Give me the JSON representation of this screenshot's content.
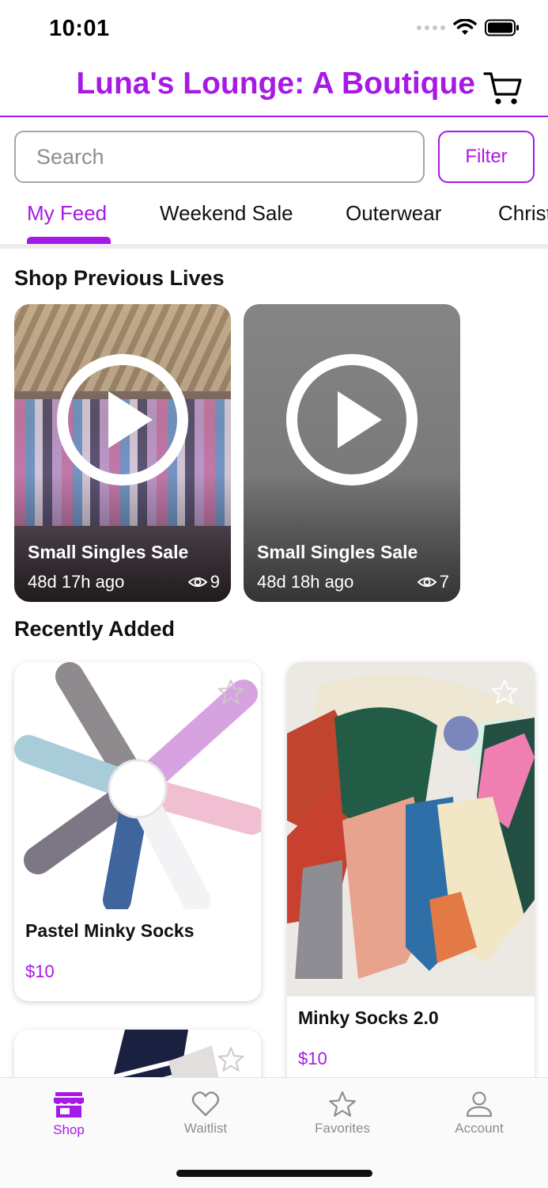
{
  "status_bar": {
    "time": "10:01"
  },
  "header": {
    "title": "Luna's Lounge: A Boutique",
    "cart_icon": "cart-icon"
  },
  "search": {
    "placeholder": "Search",
    "value": ""
  },
  "filter": {
    "label": "Filter"
  },
  "tabs": [
    {
      "label": "My Feed",
      "active": true
    },
    {
      "label": "Weekend Sale",
      "active": false
    },
    {
      "label": "Outerwear",
      "active": false
    },
    {
      "label": "Christ",
      "active": false
    }
  ],
  "previous_lives": {
    "title": "Shop Previous Lives",
    "items": [
      {
        "title": "Small Singles Sale",
        "ago": "48d 17h ago",
        "views": "9"
      },
      {
        "title": "Small Singles Sale",
        "ago": "48d 18h ago",
        "views": "7"
      }
    ]
  },
  "recently_added": {
    "title": "Recently Added",
    "items": [
      {
        "name": "Pastel Minky Socks",
        "price": "$10"
      },
      {
        "name": "Minky Socks 2.0",
        "price": "$10"
      },
      {
        "name": "",
        "price": ""
      }
    ]
  },
  "bottom_nav": [
    {
      "label": "Shop",
      "icon": "store-icon",
      "active": true
    },
    {
      "label": "Waitlist",
      "icon": "heart-icon",
      "active": false
    },
    {
      "label": "Favorites",
      "icon": "star-icon",
      "active": false
    },
    {
      "label": "Account",
      "icon": "person-icon",
      "active": false
    }
  ],
  "colors": {
    "accent": "#a719e6",
    "inactive": "#8e8e93"
  }
}
